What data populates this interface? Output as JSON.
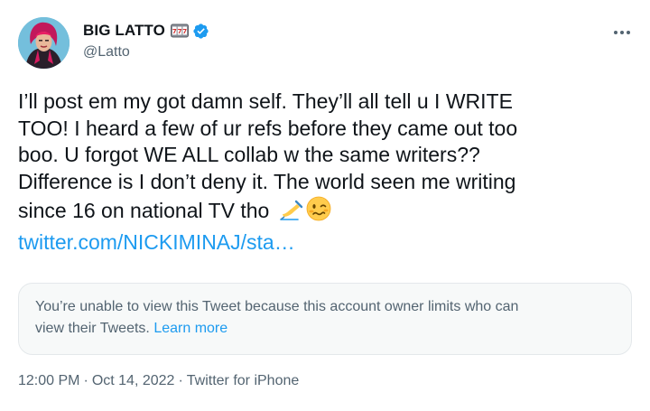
{
  "author": {
    "display_name": "BIG LATTO",
    "handle": "@Latto",
    "name_emoji_icon": "slot-machine-icon",
    "verified_icon": "verified-badge-icon",
    "avatar_icon": "profile-avatar"
  },
  "tweet": {
    "lines": [
      "I’ll post em my got damn self. They’ll all tell u I WRITE",
      "TOO! I heard a few of ur refs before they came out too",
      "boo. U forgot WE ALL collab w the same writers??",
      "Difference is I don’t deny it. The world seen me writing",
      "since 16 on national TV tho"
    ],
    "emojis": [
      "writing-hand-icon",
      "woozy-face-icon"
    ],
    "link": "twitter.com/NICKIMINAJ/sta…"
  },
  "notice": {
    "line1": "You’re unable to view this Tweet because this account owner limits who can",
    "line2": "view their Tweets.",
    "learn_more": "Learn more"
  },
  "meta": {
    "time": "12:00 PM",
    "separator": "·",
    "date": "Oct 14, 2022",
    "source": "Twitter for iPhone"
  },
  "colors": {
    "text": "#0f1419",
    "secondary": "#536471",
    "link": "#1d9bf0",
    "verified": "#1d9bf0",
    "card_bg": "#f7f9f9"
  }
}
